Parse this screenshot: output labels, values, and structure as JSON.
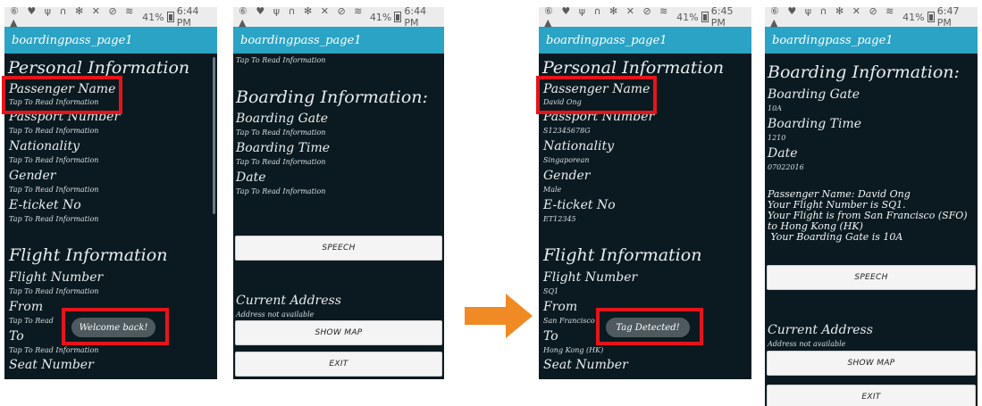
{
  "status": {
    "icons": "⑥ ♥ ψ ∩   ✻ ✕ ⊘ ≋ ▲",
    "battery": "41%"
  },
  "screens": [
    {
      "time": "6:44 PM",
      "title": "boardingpass_page1"
    },
    {
      "time": "6:44 PM",
      "title": "boardingpass_page1"
    },
    {
      "time": "6:45 PM",
      "title": "boardingpass_page1"
    },
    {
      "time": "6:47 PM",
      "title": "boardingpass_page1"
    }
  ],
  "labels": {
    "personal_info": "Personal Information",
    "passenger_name": "Passenger Name",
    "passport_number": "Passport Number",
    "nationality": "Nationality",
    "gender": "Gender",
    "eticket": "E-ticket No",
    "flight_info": "Flight Information",
    "flight_number": "Flight Number",
    "from": "From",
    "to": "To",
    "seat_number": "Seat Number",
    "boarding_info": "Boarding Information:",
    "boarding_gate": "Boarding Gate",
    "boarding_time": "Boarding Time",
    "date": "Date",
    "current_address": "Current Address",
    "tap_to_read": "Tap To Read Information",
    "tap_to_read_trunc": "Tap To Read",
    "address_na": "Address not available"
  },
  "buttons": {
    "speech": "SPEECH",
    "show_map": "SHOW MAP",
    "exit": "EXIT"
  },
  "toasts": {
    "welcome": "Welcome back!",
    "tag": "Tag Detected!"
  },
  "values": {
    "passenger_name": "David Ong",
    "passport": "S12345678G",
    "nationality": "Singaporean",
    "gender": "Male",
    "eticket": "ET12345",
    "flight": "SQ1",
    "from": "San Francisco",
    "to": "Hong Kong (HK)",
    "gate": "10A",
    "time": "1210",
    "date": "07022016"
  },
  "summary": [
    "Passenger Name: David Ong",
    "Your Flight Number is SQ1.",
    "Your Flight is from San Francisco (SFO)",
    "to Hong Kong (HK)",
    " Your Boarding Gate is 10A"
  ],
  "colors": {
    "appbar": "#2aa3c4",
    "screen_bg": "#0b1a20",
    "highlight": "#e5141b",
    "arrow": "#f08a24"
  }
}
